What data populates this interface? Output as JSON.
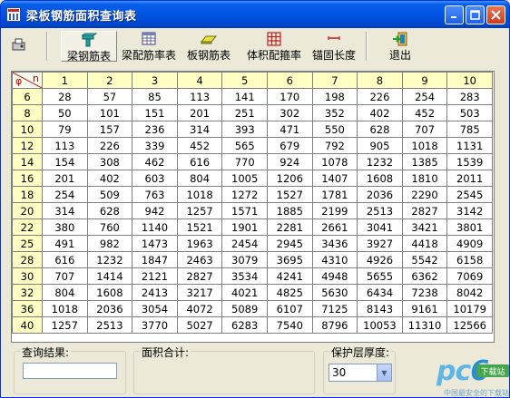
{
  "window": {
    "title": "梁板钢筋面积查询表"
  },
  "toolbar": {
    "items": [
      {
        "label": "梁钢筋表"
      },
      {
        "label": "梁配筋率表"
      },
      {
        "label": "板钢筋表"
      },
      {
        "label": "体积配箍率"
      },
      {
        "label": "锚固长度"
      },
      {
        "label": "退出"
      }
    ]
  },
  "grid": {
    "corner": {
      "row_symbol": "φ",
      "col_symbol": "n"
    },
    "columns": [
      "1",
      "2",
      "3",
      "4",
      "5",
      "6",
      "7",
      "8",
      "9",
      "10"
    ],
    "rows": [
      {
        "d": "6",
        "values": [
          "28",
          "57",
          "85",
          "113",
          "141",
          "170",
          "198",
          "226",
          "254",
          "283"
        ]
      },
      {
        "d": "8",
        "values": [
          "50",
          "101",
          "151",
          "201",
          "251",
          "302",
          "352",
          "402",
          "452",
          "503"
        ]
      },
      {
        "d": "10",
        "values": [
          "79",
          "157",
          "236",
          "314",
          "393",
          "471",
          "550",
          "628",
          "707",
          "785"
        ]
      },
      {
        "d": "12",
        "values": [
          "113",
          "226",
          "339",
          "452",
          "565",
          "679",
          "792",
          "905",
          "1018",
          "1131"
        ]
      },
      {
        "d": "14",
        "values": [
          "154",
          "308",
          "462",
          "616",
          "770",
          "924",
          "1078",
          "1232",
          "1385",
          "1539"
        ]
      },
      {
        "d": "16",
        "values": [
          "201",
          "402",
          "603",
          "804",
          "1005",
          "1206",
          "1407",
          "1608",
          "1810",
          "2011"
        ]
      },
      {
        "d": "18",
        "values": [
          "254",
          "509",
          "763",
          "1018",
          "1272",
          "1527",
          "1781",
          "2036",
          "2290",
          "2545"
        ]
      },
      {
        "d": "20",
        "values": [
          "314",
          "628",
          "942",
          "1257",
          "1571",
          "1885",
          "2199",
          "2513",
          "2827",
          "3142"
        ]
      },
      {
        "d": "22",
        "values": [
          "380",
          "760",
          "1140",
          "1521",
          "1901",
          "2281",
          "2661",
          "3041",
          "3421",
          "3801"
        ]
      },
      {
        "d": "25",
        "values": [
          "491",
          "982",
          "1473",
          "1963",
          "2454",
          "2945",
          "3436",
          "3927",
          "4418",
          "4909"
        ]
      },
      {
        "d": "28",
        "values": [
          "616",
          "1232",
          "1847",
          "2463",
          "3079",
          "3695",
          "4310",
          "4926",
          "5542",
          "6158"
        ]
      },
      {
        "d": "30",
        "values": [
          "707",
          "1414",
          "2121",
          "2827",
          "3534",
          "4241",
          "4948",
          "5655",
          "6362",
          "7069"
        ]
      },
      {
        "d": "32",
        "values": [
          "804",
          "1608",
          "2413",
          "3217",
          "4021",
          "4825",
          "5630",
          "6434",
          "7238",
          "8042"
        ]
      },
      {
        "d": "36",
        "values": [
          "1018",
          "2036",
          "3054",
          "4072",
          "5089",
          "6107",
          "7125",
          "8143",
          "9161",
          "10179"
        ]
      },
      {
        "d": "40",
        "values": [
          "1257",
          "2513",
          "3770",
          "5027",
          "6283",
          "7540",
          "8796",
          "10053",
          "11310",
          "12566"
        ]
      }
    ]
  },
  "bottom": {
    "query_result": {
      "label": "查询结果:",
      "value": ""
    },
    "area_total": {
      "label": "面积合计:",
      "value": ""
    },
    "cover": {
      "label": "保护层厚度:",
      "value": "30"
    }
  },
  "watermark": {
    "brand": "pc",
    "brand_digit": "6",
    "badge": "下载站",
    "sub": "中国最安全的下载站"
  },
  "colors": {
    "header_bg": "#ffffc4",
    "title_bar": "#0055e5",
    "corner_text": "#c00000"
  }
}
